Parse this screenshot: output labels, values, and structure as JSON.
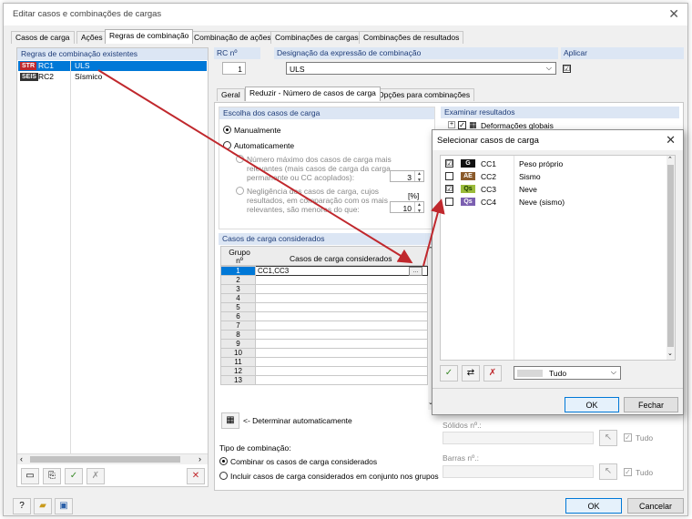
{
  "window": {
    "title": "Editar casos e combinações de cargas"
  },
  "tabs": [
    "Casos de carga",
    "Ações",
    "Regras de combinação",
    "Combinação de ações",
    "Combinações de cargas",
    "Combinações de resultados"
  ],
  "rules": {
    "header": "Regras de combinação existentes",
    "items": [
      {
        "tag": "STR",
        "tag_color": "#c0282d",
        "id": "RC1",
        "name": "ULS",
        "selected": true
      },
      {
        "tag": "SEIS",
        "tag_color": "#333333",
        "id": "RC2",
        "name": "Sísmico",
        "selected": false
      }
    ]
  },
  "rc": {
    "label": "RC nº",
    "value": "1"
  },
  "designation": {
    "label": "Designação da expressão de combinação",
    "value": "ULS"
  },
  "apply": {
    "label": "Aplicar",
    "checked": "☑"
  },
  "subtabs": [
    "Geral",
    "Reduzir - Número de casos de carga",
    "Opções para combinações"
  ],
  "choice": {
    "header": "Escolha dos casos de carga",
    "manual": "Manualmente",
    "auto": "Automaticamente",
    "max_line1": "Número máximo dos casos de carga mais",
    "max_line2": "relevantes (mais casos de carga da carga",
    "max_line3": "permanente ou CC acoplados):",
    "max_value": "3",
    "neg_line1": "Negligência dos casos de carga, cujos",
    "neg_line2": "resultados, em comparação com os mais",
    "neg_line3": "relevantes, são menores do que:",
    "neg_unit": "[%]",
    "neg_value": "10"
  },
  "examine": {
    "header": "Examinar resultados",
    "item": "Deformações globais"
  },
  "considered": {
    "header": "Casos de carga considerados",
    "col_group": "Grupo nº",
    "col_cases": "Casos de carga considerados",
    "rows": [
      {
        "n": "1",
        "v": "CC1,CC3"
      },
      {
        "n": "2",
        "v": ""
      },
      {
        "n": "3",
        "v": ""
      },
      {
        "n": "4",
        "v": ""
      },
      {
        "n": "5",
        "v": ""
      },
      {
        "n": "6",
        "v": ""
      },
      {
        "n": "7",
        "v": ""
      },
      {
        "n": "8",
        "v": ""
      },
      {
        "n": "9",
        "v": ""
      },
      {
        "n": "10",
        "v": ""
      },
      {
        "n": "11",
        "v": ""
      },
      {
        "n": "12",
        "v": ""
      },
      {
        "n": "13",
        "v": ""
      }
    ],
    "auto_determine": "<- Determinar automaticamente"
  },
  "combo_type": {
    "label": "Tipo de combinação:",
    "opt1": "Combinar os casos de carga considerados",
    "opt2": "Incluir casos de carga considerados em conjunto nos grupos"
  },
  "right_bottom": {
    "solids": "Sólidos nº.:",
    "bars": "Barras nº.:",
    "all": "Tudo"
  },
  "dialog": {
    "title": "Selecionar casos de carga",
    "items": [
      {
        "checked": "☑",
        "tag": "G",
        "tag_color": "#111111",
        "id": "CC1",
        "name": "Peso próprio"
      },
      {
        "checked": "",
        "tag": "AE",
        "tag_color": "#8a5a2b",
        "id": "CC2",
        "name": "Sismo"
      },
      {
        "checked": "☑",
        "tag": "Qs",
        "tag_color": "#9bbb3b",
        "id": "CC3",
        "name": "Neve"
      },
      {
        "checked": "",
        "tag": "Qs",
        "tag_color": "#7b5fb0",
        "id": "CC4",
        "name": "Neve (sismo)"
      }
    ],
    "filter": "Tudo",
    "ok": "OK",
    "close": "Fechar"
  },
  "footer": {
    "ok": "OK",
    "cancel": "Cancelar"
  },
  "colors": {
    "selection": "#0078d7",
    "group_header": "#dce6f4",
    "arrow": "#c0282d"
  }
}
